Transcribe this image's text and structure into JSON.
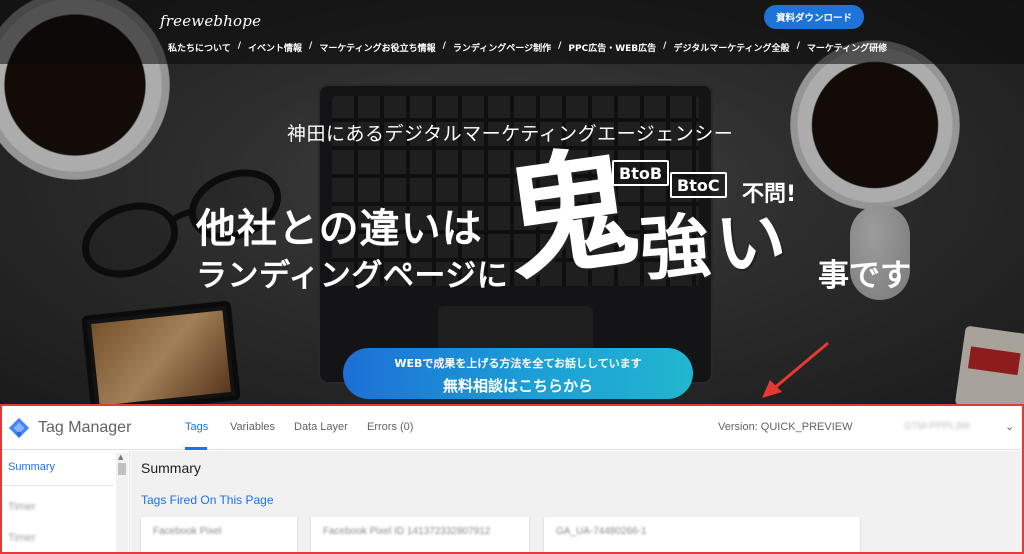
{
  "site": {
    "logo_text": "freewebhope",
    "cta_doc_label": "資料ダウンロード",
    "nav": [
      "私たちについて",
      "イベント情報",
      "マーケティングお役立ち情報",
      "ランディングページ制作",
      "PPC広告・WEB広告",
      "デジタルマーケティング全般",
      "マーケティング研修"
    ],
    "nav_separator": "/",
    "hero": {
      "subheadline": "神田にあるデジタルマーケティングエージェンシー",
      "line1": "他社との違いは",
      "line2": "ランディングページに",
      "oni": "鬼",
      "tsuyoi": "強い",
      "tail": "事です",
      "badge_btob": "BtoB",
      "badge_btoc": "BtoC",
      "fumon": "不問!"
    },
    "consult": {
      "line1": "WEBで成果を上げる方法を全てお話ししています",
      "line2": "無料相談はこちらから"
    }
  },
  "tag_manager": {
    "title": "Tag Manager",
    "tabs": [
      "Tags",
      "Variables",
      "Data Layer",
      "Errors (0)"
    ],
    "version": "Version: QUICK_PREVIEW",
    "container_id": "GTM-PPPL3W",
    "sidebar": {
      "active": "Summary",
      "items": [
        "Timer",
        "Timer"
      ]
    },
    "main": {
      "title": "Summary",
      "fired_title": "Tags Fired On This Page",
      "cards": [
        "Facebook Pixel",
        "Facebook Pixel ID 141372332807912",
        "GA_UA-74480266-1"
      ]
    },
    "colors": {
      "accent": "#1a73e8",
      "frame": "#e53935"
    }
  }
}
